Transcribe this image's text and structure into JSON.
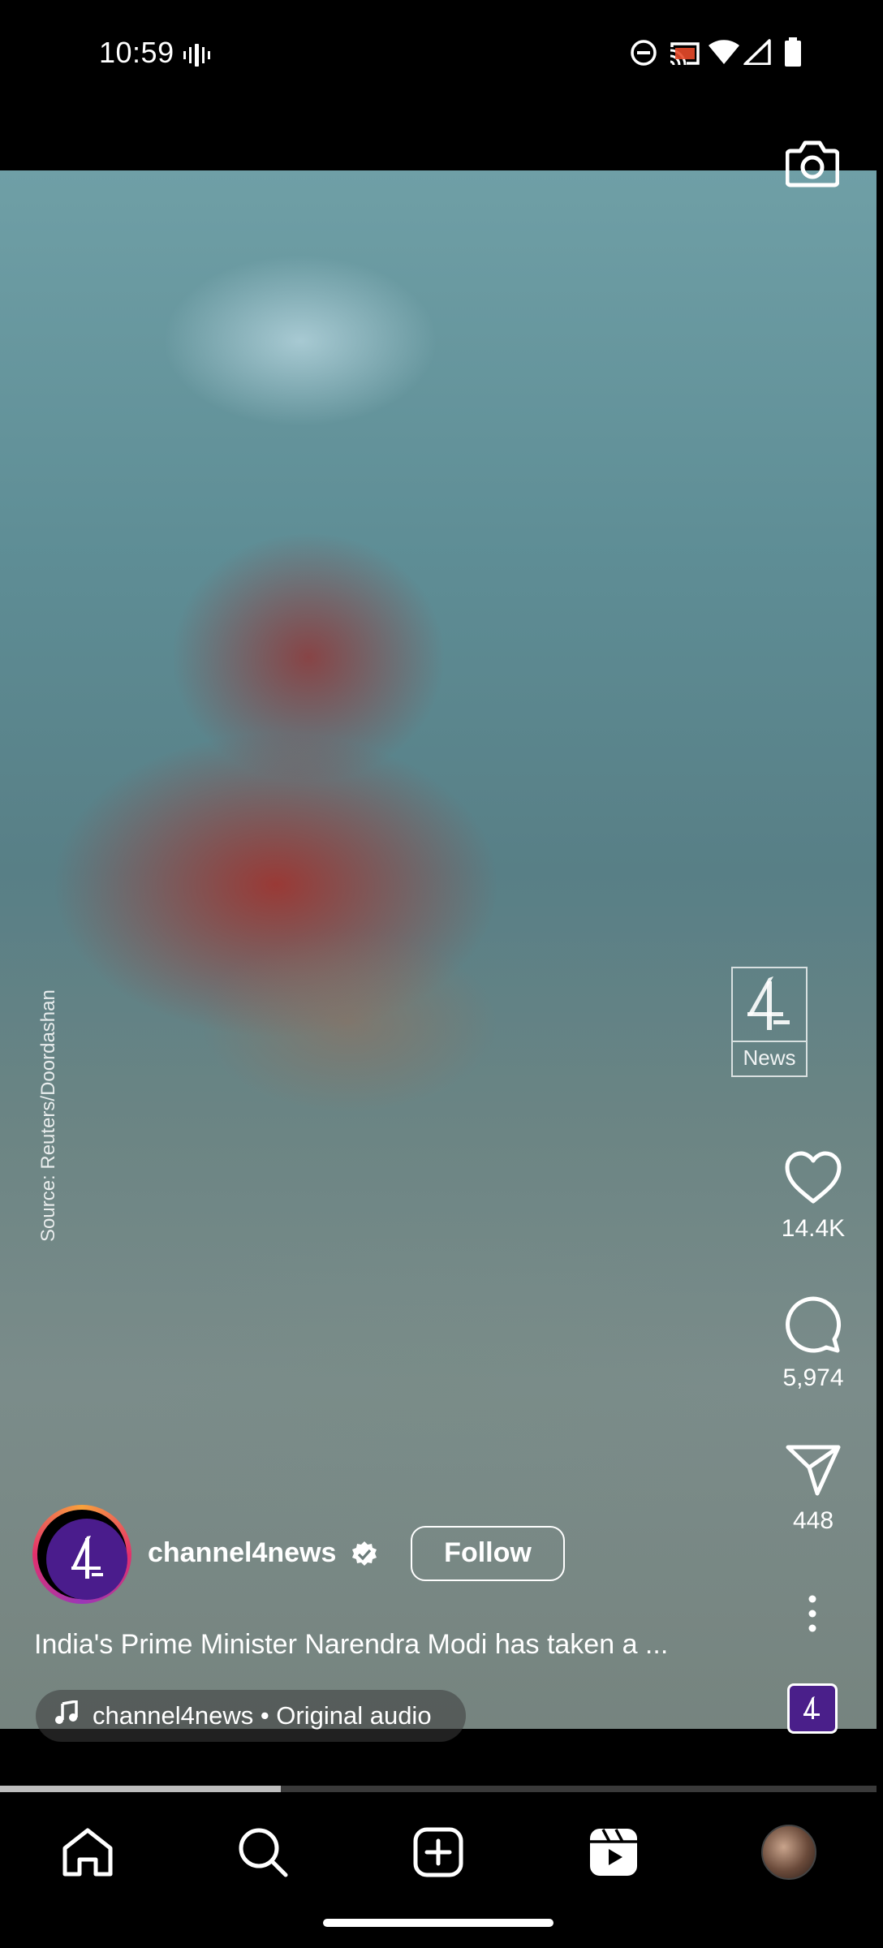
{
  "status_bar": {
    "time": "10:59",
    "icons": [
      "vibrate-icon",
      "do-not-disturb-icon",
      "cast-icon",
      "wifi-icon",
      "signal-icon",
      "battery-icon"
    ]
  },
  "video": {
    "source_text": "Source: Reuters/Doordashan",
    "watermark_label": "News"
  },
  "actions": {
    "likes": "14.4K",
    "comments": "5,974",
    "shares": "448"
  },
  "author": {
    "username": "channel4news",
    "follow_label": "Follow",
    "verified": true
  },
  "caption": "India's Prime Minister Narendra Modi has taken a ...",
  "audio": {
    "label": "channel4news • Original audio"
  },
  "progress": {
    "fraction": 0.32
  },
  "nav": {
    "items": [
      "home-icon",
      "search-icon",
      "create-icon",
      "reels-icon",
      "profile-avatar"
    ]
  },
  "colors": {
    "brand_purple": "#4a1c8c",
    "background": "#000000",
    "text": "#ffffff"
  }
}
